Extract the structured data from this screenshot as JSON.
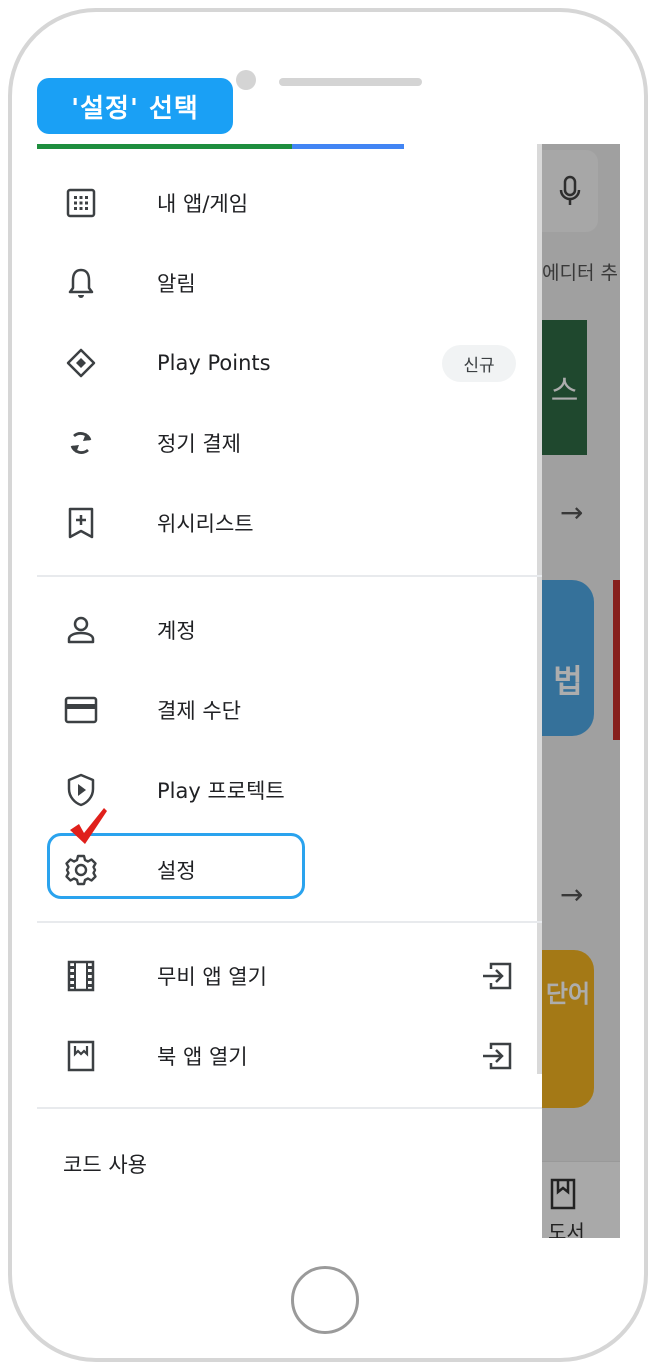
{
  "step_badge": "'설정' 선택",
  "drawer": {
    "section1": [
      {
        "label": "내 앱/게임",
        "icon": "grid-apps-icon"
      },
      {
        "label": "알림",
        "icon": "bell-icon"
      },
      {
        "label": "Play Points",
        "icon": "diamond-icon",
        "badge": "신규"
      },
      {
        "label": "정기 결제",
        "icon": "refresh-icon"
      },
      {
        "label": "위시리스트",
        "icon": "bookmark-add-icon"
      }
    ],
    "section2": [
      {
        "label": "계정",
        "icon": "person-icon"
      },
      {
        "label": "결제 수단",
        "icon": "credit-card-icon"
      },
      {
        "label": "Play 프로텍트",
        "icon": "shield-play-icon"
      },
      {
        "label": "설정",
        "icon": "gear-icon"
      }
    ],
    "section3": [
      {
        "label": "무비 앱 열기",
        "icon": "film-icon",
        "trailing_icon": "open-app-icon"
      },
      {
        "label": "북 앱 열기",
        "icon": "book-icon",
        "trailing_icon": "open-app-icon"
      }
    ],
    "section4": [
      {
        "label": "코드 사용"
      }
    ]
  },
  "background": {
    "tabs_text": "에디터 추",
    "banner_text": "스",
    "app_icon1_text": "법",
    "app_icon2_text": "단어",
    "bottom_nav_label": "도서"
  },
  "colors": {
    "accent_blue": "#1aa0f5",
    "highlight_border": "#2aa3ee",
    "check_red": "#e0201b",
    "bar_green": "#1e8e3e",
    "bar_blue": "#4285f4"
  }
}
